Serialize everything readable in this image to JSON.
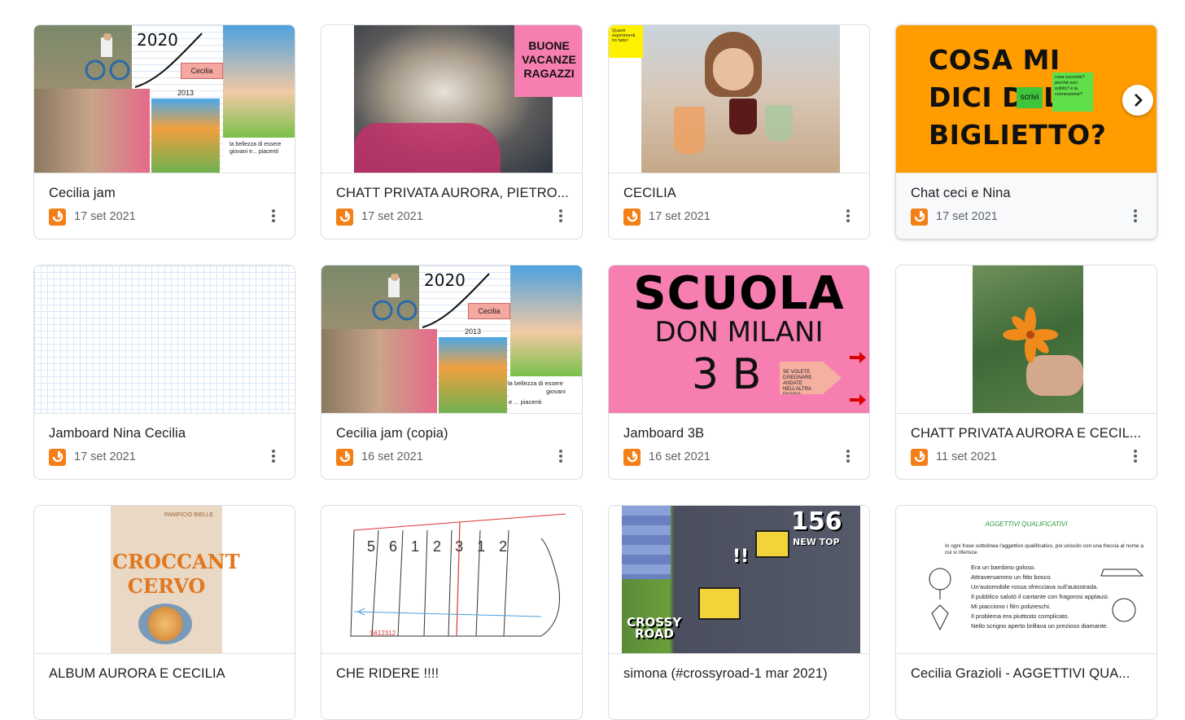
{
  "colors": {
    "accent": "#f57f17",
    "border": "#dadce0",
    "pink": "#f77eb0",
    "orange": "#ff9c00"
  },
  "cards": [
    {
      "title": "Cecilia jam",
      "date": "17 set 2021",
      "thumb": {
        "year": "2020",
        "arrow": "Cecilia",
        "year2": "2013",
        "caption": "la bellezza di essere giovani e... piacenti"
      }
    },
    {
      "title": "CHATT PRIVATA AURORA, PIETRO...",
      "date": "17 set 2021",
      "thumb": {
        "note": "BUONE VACANZE RAGAZZI"
      }
    },
    {
      "title": "CECILIA",
      "date": "17 set 2021",
      "thumb": {
        "note": "Quanti esperimenti ho fatto!"
      }
    },
    {
      "title": "Chat ceci e Nina",
      "date": "17 set 2021",
      "thumb": {
        "text": "COSA MI DICI DEL BIGLIETTO?",
        "sticky1": "scrivi",
        "sticky2": "cosa succede? perché esci subito? è la connessione?"
      }
    },
    {
      "title": "Jamboard Nina Cecilia",
      "date": "17 set 2021",
      "thumb": {}
    },
    {
      "title": "Cecilia jam (copia)",
      "date": "16 set 2021",
      "thumb": {
        "year": "2020",
        "arrow": "Cecilia",
        "year2": "2013",
        "caption1": "la bellezza di essere",
        "caption2": "giovani",
        "caption3": "e ... piacenti"
      }
    },
    {
      "title": "Jamboard 3B",
      "date": "16 set 2021",
      "thumb": {
        "line1": "SCUOLA",
        "line2": "DON MILANI",
        "line3": "3 B",
        "arrow": "SE VOLETE DISEGNARE ANDATE NELL'ALTRA PAGINA"
      }
    },
    {
      "title": "CHATT PRIVATA AURORA E CECIL...",
      "date": "11 set 2021",
      "thumb": {}
    },
    {
      "title": "ALBUM AURORA E CECILIA",
      "date": "",
      "thumb": {
        "line1": "CROCCANT",
        "line2": "CERVO",
        "top": "PANIFICIO BIELLE"
      }
    },
    {
      "title": "CHE RIDERE !!!!",
      "date": "",
      "thumb": {
        "numbers": [
          "5",
          "6",
          "1",
          "2",
          "3",
          "1",
          "2"
        ],
        "note": "5612312"
      }
    },
    {
      "title": "simona (#crossyroad-1 mar 2021)",
      "date": "",
      "thumb": {
        "score": "156",
        "sub": "NEW TOP",
        "logo1": "CROSSY",
        "logo2": "ROAD",
        "mark": "!!"
      }
    },
    {
      "title": "Cecilia Grazioli - AGGETTIVI QUA...",
      "date": "",
      "thumb": {
        "heading": "AGGETTIVI QUALIFICATIVI",
        "intro": "In ogni frase sottolinea l'aggettivo qualificativo, poi uniscilo con una freccia al nome a cui si riferisce.",
        "lines": [
          "Era un bambino goloso.",
          "Attraversammo un fitto bosco.",
          "Un'automobile rossa sfrecciava sull'autostrada.",
          "Il pubblico salutò il cantante con fragorosi applausi.",
          "Mi piacciono i film polizieschi.",
          "Il problema era piuttosto complicato.",
          "Nello scrigno aperto brillava un prezioso diamante."
        ]
      }
    }
  ]
}
